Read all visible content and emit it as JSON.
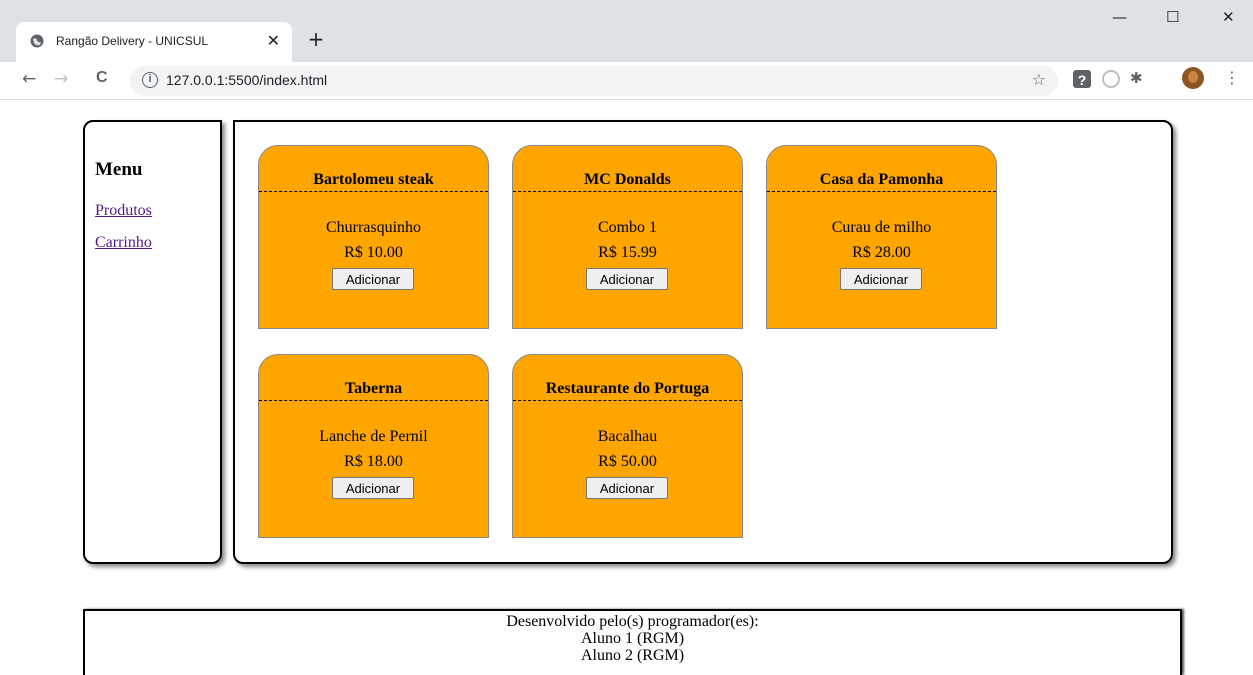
{
  "browser": {
    "tab_title": "Rangão Delivery - UNICSUL",
    "tab_close": "✕",
    "new_tab": "+",
    "url": "127.0.0.1:5500/index.html",
    "info_glyph": "i",
    "star_glyph": "☆",
    "back_glyph": "←",
    "forward_glyph": "→",
    "reload_glyph": "C",
    "minimize_glyph": "—",
    "maximize_glyph": "☐",
    "close_glyph": "✕",
    "help_glyph": "?",
    "puzzle_glyph": "✱",
    "kebab_glyph": "⋮"
  },
  "sidebar": {
    "title": "Menu",
    "links": [
      "Produtos",
      "Carrinho"
    ]
  },
  "products": [
    {
      "restaurant": "Bartolomeu steak",
      "item": "Churrasquinho",
      "price": "R$ 10.00",
      "button": "Adicionar"
    },
    {
      "restaurant": "MC Donalds",
      "item": "Combo 1",
      "price": "R$ 15.99",
      "button": "Adicionar"
    },
    {
      "restaurant": "Casa da Pamonha",
      "item": "Curau de milho",
      "price": "R$ 28.00",
      "button": "Adicionar"
    },
    {
      "restaurant": "Taberna",
      "item": "Lanche de Pernil",
      "price": "R$ 18.00",
      "button": "Adicionar"
    },
    {
      "restaurant": "Restaurante do Portuga",
      "item": "Bacalhau",
      "price": "R$ 50.00",
      "button": "Adicionar"
    }
  ],
  "footer": {
    "line1": "Desenvolvido pelo(s) programador(es):",
    "line2": "Aluno 1 (RGM)",
    "line3": "Aluno 2 (RGM)"
  },
  "colors": {
    "card_background": "#ffa500",
    "link": "#551a8b"
  }
}
